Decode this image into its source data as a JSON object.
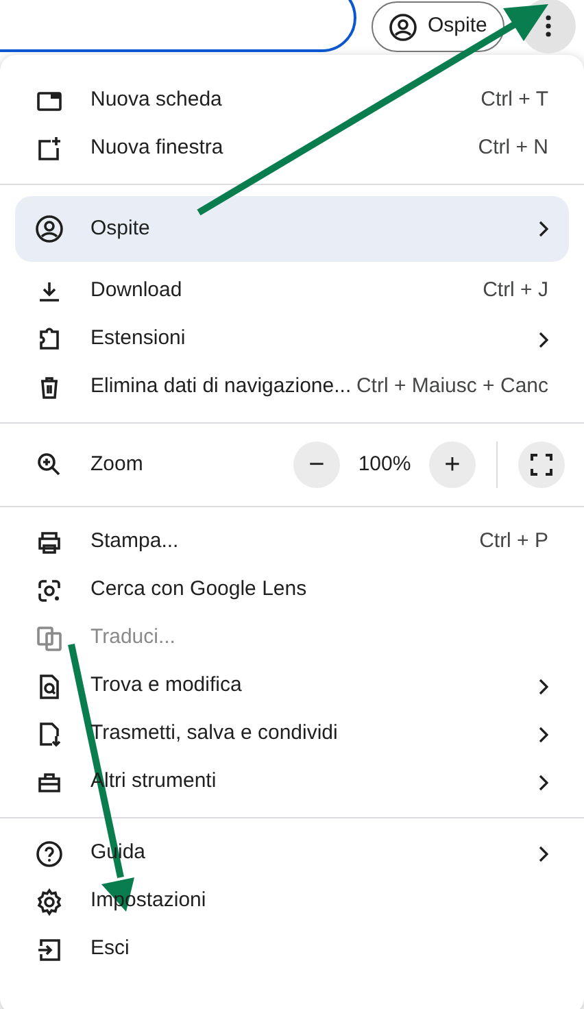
{
  "toolbar": {
    "profile_chip": "Ospite"
  },
  "menu": {
    "sections": [
      {
        "items": [
          {
            "kind": "item",
            "label": "Nuova scheda",
            "shortcut": "Ctrl + T",
            "submenu": false,
            "disabled": false
          },
          {
            "kind": "item",
            "label": "Nuova finestra",
            "shortcut": "Ctrl + N",
            "submenu": false,
            "disabled": false
          }
        ]
      },
      {
        "items": [
          {
            "kind": "profile",
            "label": "Ospite",
            "submenu": true,
            "disabled": false
          },
          {
            "kind": "item",
            "label": "Download",
            "shortcut": "Ctrl + J",
            "submenu": false,
            "disabled": false
          },
          {
            "kind": "item",
            "label": "Estensioni",
            "submenu": true,
            "disabled": false
          },
          {
            "kind": "item",
            "label": "Elimina dati di navigazione...",
            "shortcut": "Ctrl + Maiusc + Canc",
            "submenu": false,
            "disabled": false
          }
        ]
      },
      {
        "items": [
          {
            "kind": "zoom",
            "label": "Zoom",
            "minus": "−",
            "value": "100%",
            "plus": "+"
          }
        ]
      },
      {
        "items": [
          {
            "kind": "item",
            "label": "Stampa...",
            "shortcut": "Ctrl + P",
            "submenu": false,
            "disabled": false
          },
          {
            "kind": "item",
            "label": "Cerca con Google Lens",
            "submenu": false,
            "disabled": false
          },
          {
            "kind": "item",
            "label": "Traduci...",
            "submenu": false,
            "disabled": true
          },
          {
            "kind": "item",
            "label": "Trova e modifica",
            "submenu": true,
            "disabled": false
          },
          {
            "kind": "item",
            "label": "Trasmetti, salva e condividi",
            "submenu": true,
            "disabled": false
          },
          {
            "kind": "item",
            "label": "Altri strumenti",
            "submenu": true,
            "disabled": false
          }
        ]
      },
      {
        "items": [
          {
            "kind": "item",
            "label": "Guida",
            "submenu": true,
            "disabled": false
          },
          {
            "kind": "item",
            "label": "Impostazioni",
            "submenu": false,
            "disabled": false
          },
          {
            "kind": "item",
            "label": "Esci",
            "submenu": false,
            "disabled": false
          }
        ]
      }
    ]
  }
}
